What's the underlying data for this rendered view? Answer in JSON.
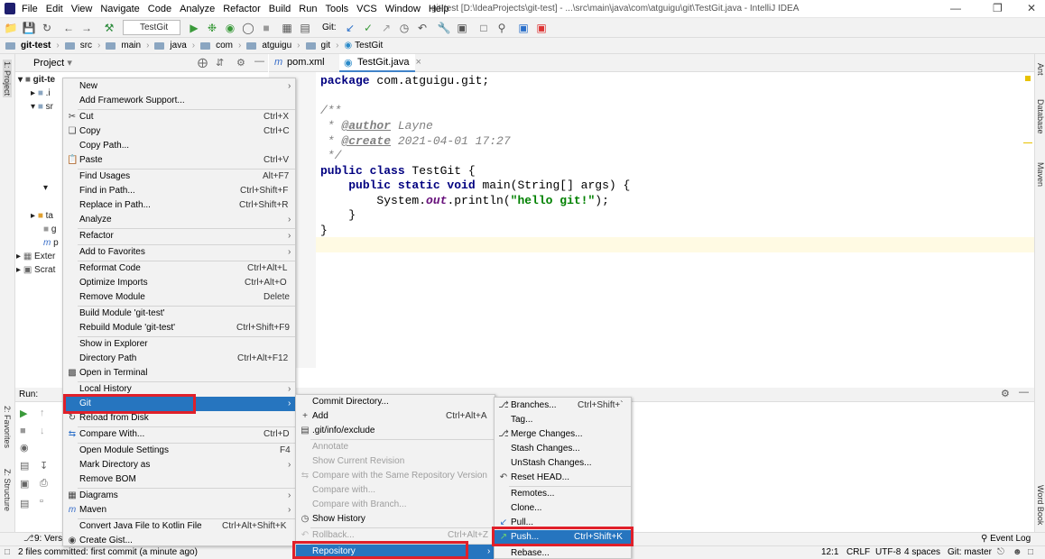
{
  "menubar": [
    "File",
    "Edit",
    "View",
    "Navigate",
    "Code",
    "Analyze",
    "Refactor",
    "Build",
    "Run",
    "Tools",
    "VCS",
    "Window",
    "Help"
  ],
  "window_title": "git-test [D:\\IdeaProjects\\git-test] - ...\\src\\main\\java\\com\\atguigu\\git\\TestGit.java - IntelliJ IDEA",
  "toolbar": {
    "run_config": "TestGit",
    "git_label": "Git:"
  },
  "breadcrumb": [
    "git-test",
    "src",
    "main",
    "java",
    "com",
    "atguigu",
    "git",
    "TestGit"
  ],
  "left_strip": {
    "project": "1: Project",
    "favorites": "2: Favorites",
    "structure": "Z: Structure"
  },
  "right_strip": {
    "ant": "Ant",
    "database": "Database",
    "maven": "Maven",
    "word_book": "Word Book"
  },
  "project_panel": {
    "title": "Project"
  },
  "tree": [
    {
      "label": "git-te"
    },
    {
      "label": ".i"
    },
    {
      "label": "sr"
    },
    {
      "label": "ta"
    },
    {
      "label": "g"
    },
    {
      "label": "p"
    },
    {
      "label": "Exter"
    },
    {
      "label": "Scrat"
    }
  ],
  "editor_tabs": [
    {
      "label": "pom.xml",
      "active": false
    },
    {
      "label": "TestGit.java",
      "active": true
    }
  ],
  "code": {
    "l1_kw": "package",
    "l1_rest": " com.atguigu.git;",
    "l3": "/**",
    "l4_pre": " * ",
    "l4_tag": "@author",
    "l4_rest": " Layne",
    "l5_pre": " * ",
    "l5_tag": "@create",
    "l5_rest": " 2021-04-01 17:27",
    "l6": " */",
    "l7_kw": "public class",
    "l7_rest": " TestGit {",
    "l8_pre": "    ",
    "l8_kw": "public static void",
    "l8_rest": " main(String[] args) {",
    "l9_pre": "        System.",
    "l9_fld": "out",
    "l9_mid": ".println(",
    "l9_str": "\"hello git!\"",
    "l9_end": ");",
    "l10": "    }",
    "l11": "}"
  },
  "run_panel": {
    "label": "Run:"
  },
  "bottom_tabs": {
    "version_control": "9: Versi",
    "event_log": "Event Log"
  },
  "status": {
    "message": "2 files committed: first commit (a minute ago)",
    "position": "12:1",
    "line_sep": "CRLF",
    "encoding": "UTF-8",
    "indent": "4 spaces",
    "branch": "Git: master"
  },
  "context_menu": [
    {
      "label": "New",
      "shortcut": "",
      "submenu": true
    },
    {
      "label": "Add Framework Support...",
      "shortcut": ""
    },
    {
      "label": "Cut",
      "shortcut": "Ctrl+X",
      "icon": "cut-icon"
    },
    {
      "label": "Copy",
      "shortcut": "Ctrl+C",
      "icon": "copy-icon"
    },
    {
      "label": "Copy Path...",
      "shortcut": ""
    },
    {
      "label": "Paste",
      "shortcut": "Ctrl+V",
      "icon": "paste-icon"
    },
    {
      "label": "Find Usages",
      "shortcut": "Alt+F7"
    },
    {
      "label": "Find in Path...",
      "shortcut": "Ctrl+Shift+F"
    },
    {
      "label": "Replace in Path...",
      "shortcut": "Ctrl+Shift+R"
    },
    {
      "label": "Analyze",
      "shortcut": "",
      "submenu": true
    },
    {
      "label": "Refactor",
      "shortcut": "",
      "submenu": true
    },
    {
      "label": "Add to Favorites",
      "shortcut": "",
      "submenu": true
    },
    {
      "label": "Reformat Code",
      "shortcut": "Ctrl+Alt+L"
    },
    {
      "label": "Optimize Imports",
      "shortcut": "Ctrl+Alt+O"
    },
    {
      "label": "Remove Module",
      "shortcut": "Delete"
    },
    {
      "label": "Build Module 'git-test'",
      "shortcut": ""
    },
    {
      "label": "Rebuild Module 'git-test'",
      "shortcut": "Ctrl+Shift+F9"
    },
    {
      "label": "Show in Explorer",
      "shortcut": ""
    },
    {
      "label": "Directory Path",
      "shortcut": "Ctrl+Alt+F12"
    },
    {
      "label": "Open in Terminal",
      "shortcut": "",
      "icon": "terminal-icon"
    },
    {
      "label": "Local History",
      "shortcut": "",
      "submenu": true
    },
    {
      "label": "Git",
      "shortcut": "",
      "submenu": true,
      "selected": true
    },
    {
      "label": "Reload from Disk",
      "shortcut": "",
      "icon": "reload-icon"
    },
    {
      "label": "Compare With...",
      "shortcut": "Ctrl+D",
      "icon": "compare-icon"
    },
    {
      "label": "Open Module Settings",
      "shortcut": "F4"
    },
    {
      "label": "Mark Directory as",
      "shortcut": "",
      "submenu": true
    },
    {
      "label": "Remove BOM",
      "shortcut": ""
    },
    {
      "label": "Diagrams",
      "shortcut": "",
      "submenu": true,
      "icon": "diagram-icon"
    },
    {
      "label": "Maven",
      "shortcut": "",
      "submenu": true,
      "icon": "maven-icon"
    },
    {
      "label": "Convert Java File to Kotlin File",
      "shortcut": "Ctrl+Alt+Shift+K"
    },
    {
      "label": "Create Gist...",
      "shortcut": "",
      "icon": "github-icon"
    }
  ],
  "git_menu": [
    {
      "label": "Commit Directory...",
      "shortcut": ""
    },
    {
      "label": "Add",
      "shortcut": "Ctrl+Alt+A",
      "icon": "plus-icon"
    },
    {
      "label": ".git/info/exclude",
      "shortcut": "",
      "icon": "git-file-icon"
    },
    {
      "label": "Annotate",
      "shortcut": "",
      "disabled": true
    },
    {
      "label": "Show Current Revision",
      "shortcut": "",
      "disabled": true
    },
    {
      "label": "Compare with the Same Repository Version",
      "shortcut": "",
      "disabled": true,
      "icon": "compare-icon"
    },
    {
      "label": "Compare with...",
      "shortcut": "",
      "disabled": true
    },
    {
      "label": "Compare with Branch...",
      "shortcut": "",
      "disabled": true
    },
    {
      "label": "Show History",
      "shortcut": "",
      "icon": "history-icon"
    },
    {
      "label": "Rollback...",
      "shortcut": "Ctrl+Alt+Z",
      "disabled": true,
      "icon": "rollback-icon"
    },
    {
      "label": "Repository",
      "shortcut": "",
      "submenu": true,
      "selected": true
    }
  ],
  "repo_menu": [
    {
      "label": "Branches...",
      "shortcut": "Ctrl+Shift+`",
      "icon": "branch-icon"
    },
    {
      "label": "Tag...",
      "shortcut": ""
    },
    {
      "label": "Merge Changes...",
      "shortcut": "",
      "icon": "merge-icon"
    },
    {
      "label": "Stash Changes...",
      "shortcut": ""
    },
    {
      "label": "UnStash Changes...",
      "shortcut": ""
    },
    {
      "label": "Reset HEAD...",
      "shortcut": "",
      "icon": "reset-icon"
    },
    {
      "label": "Remotes...",
      "shortcut": ""
    },
    {
      "label": "Clone...",
      "shortcut": ""
    },
    {
      "label": "Pull...",
      "shortcut": "",
      "icon": "pull-icon"
    },
    {
      "label": "Push...",
      "shortcut": "Ctrl+Shift+K",
      "selected": true,
      "icon": "push-icon"
    },
    {
      "label": "Rebase...",
      "shortcut": ""
    }
  ],
  "colors": {
    "selection": "#2675bf",
    "highlight_box": "#e0202a",
    "menu_bg": "#f2f2f2"
  }
}
